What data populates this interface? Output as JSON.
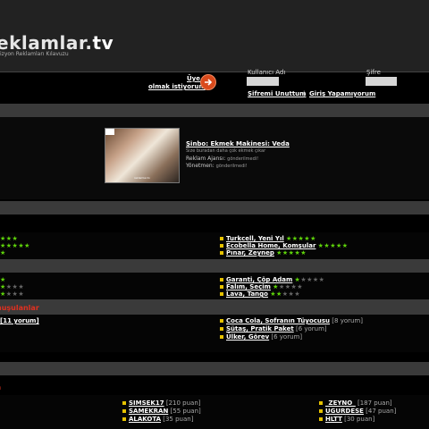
{
  "header": {
    "logo_prefix": "eklamlar.",
    "logo_suffix": "tv",
    "tagline": "izyon Reklamları Kılavuzu"
  },
  "login": {
    "signup_line1": "Üye",
    "signup_line2": "olmak istiyorum",
    "username_label": "Kullanıcı Adı",
    "password_label": "Şifre",
    "forgot_label": "Şifremi Unuttum",
    "separator": "|",
    "cant_login_label": "Giriş Yapamıyorum"
  },
  "featured": {
    "title": "Şinbo: Ekmek Makinesi: Veda",
    "description": "Size buradan daha çok ekmek çıkar",
    "agency_label": "Reklam Ajansı:",
    "agency_value": "gönderilmedi!",
    "director_label": "Yönetmen:",
    "director_value": "gönderilmedi!",
    "thumb_badge": "",
    "thumb_caption": "reklamlar.tv"
  },
  "top_rated_left": [
    {
      "stars": "★★★",
      "off": ""
    },
    {
      "stars": "★★★★★",
      "off": ""
    },
    {
      "stars": "★",
      "off": ""
    }
  ],
  "top_rated_right": [
    {
      "label": "Turkcell, Yeni Yıl",
      "stars": "★★★★★",
      "off": ""
    },
    {
      "label": "Ecobella Home, Komşular",
      "stars": "★★★★★",
      "off": ""
    },
    {
      "label": "Pınar, Zeynep",
      "stars": "★★★★★",
      "off": ""
    }
  ],
  "low_rated_left": [
    {
      "stars": "★",
      "off": ""
    },
    {
      "stars": "★",
      "off": "★★★"
    },
    {
      "stars": "★",
      "off": "★★★"
    }
  ],
  "low_rated_right": [
    {
      "label": "Garanti, Çöp Adam",
      "stars": "★",
      "off": "★★★★"
    },
    {
      "label": "Falım, Seçim",
      "stars": "★",
      "off": "★★★★"
    },
    {
      "label": "Lava, Tango",
      "stars": "★★",
      "off": "★★★"
    }
  ],
  "discussed": {
    "title": "nuşulanlar",
    "left_count": "[11 yorum]",
    "right": [
      {
        "label": "Coca Cola, Sofranın Tüyocusu",
        "count": "[8 yorum]"
      },
      {
        "label": "Sütaş, Pratik Paket",
        "count": "[6 yorum]"
      },
      {
        "label": "Ülker, Görev",
        "count": "[6 yorum]"
      }
    ]
  },
  "users": {
    "red_text": "i",
    "middle": [
      {
        "label": "SIMSEK17",
        "count": "[210 puan]"
      },
      {
        "label": "SAMEKRAN",
        "count": "[55 puan]"
      },
      {
        "label": "ALAKOTA",
        "count": "[35 puan]"
      }
    ],
    "right": [
      {
        "label": "_ZEYNO_",
        "count": "[187 puan]"
      },
      {
        "label": "UGURDESE",
        "count": "[47 puan]"
      },
      {
        "label": "HLTT",
        "count": "[30 puan]"
      }
    ]
  },
  "colors": {
    "accent": "#e6c200",
    "stars": "#5ed30a",
    "red": "#e03020",
    "button": "#d94a1c"
  }
}
